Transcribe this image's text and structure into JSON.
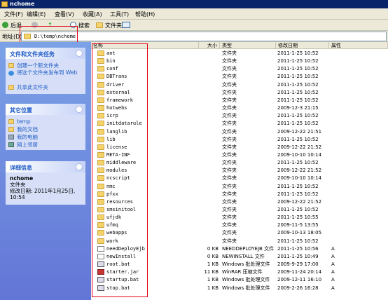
{
  "window": {
    "title": "nchome"
  },
  "menu": [
    "文件(F)",
    "编辑(E)",
    "查看(V)",
    "收藏(A)",
    "工具(T)",
    "帮助(H)"
  ],
  "toolbar": {
    "back": "后退",
    "search": "搜索",
    "folders": "文件夹"
  },
  "address": {
    "label": "地址(D)",
    "value": "D:\\temp\\nchome"
  },
  "tasks": {
    "header": "文件和文件夹任务",
    "items": [
      "创建一个新文件夹",
      "将这个文件夹发布到 Web",
      "共享此文件夹"
    ]
  },
  "places": {
    "header": "其它位置",
    "items": [
      "temp",
      "我的文档",
      "我的电脑",
      "网上邻居"
    ]
  },
  "details": {
    "header": "详细信息",
    "name": "nchome",
    "type": "文件夹",
    "modified": "修改日期: 2011年1月25日, 10:54"
  },
  "columns": [
    "名称",
    "大小",
    "类型",
    "修改日期",
    "属性"
  ],
  "files": [
    {
      "name": "ant",
      "size": "",
      "type": "文件夹",
      "date": "2011-1-25 10:52",
      "attr": "",
      "kind": "folder"
    },
    {
      "name": "bin",
      "size": "",
      "type": "文件夹",
      "date": "2011-1-25 10:52",
      "attr": "",
      "kind": "folder"
    },
    {
      "name": "conf",
      "size": "",
      "type": "文件夹",
      "date": "2011-1-25 10:52",
      "attr": "",
      "kind": "folder"
    },
    {
      "name": "DBTrans",
      "size": "",
      "type": "文件夹",
      "date": "2011-1-25 10:52",
      "attr": "",
      "kind": "folder"
    },
    {
      "name": "driver",
      "size": "",
      "type": "文件夹",
      "date": "2011-1-25 10:52",
      "attr": "",
      "kind": "folder"
    },
    {
      "name": "external",
      "size": "",
      "type": "文件夹",
      "date": "2011-1-25 10:52",
      "attr": "",
      "kind": "folder"
    },
    {
      "name": "framework",
      "size": "",
      "type": "文件夹",
      "date": "2011-1-25 10:52",
      "attr": "",
      "kind": "folder"
    },
    {
      "name": "hotwebs",
      "size": "",
      "type": "文件夹",
      "date": "2009-12-3 21:15",
      "attr": "",
      "kind": "folder"
    },
    {
      "name": "icrp",
      "size": "",
      "type": "文件夹",
      "date": "2011-1-25 10:52",
      "attr": "",
      "kind": "folder"
    },
    {
      "name": "initdatarule",
      "size": "",
      "type": "文件夹",
      "date": "2011-1-25 10:52",
      "attr": "",
      "kind": "folder"
    },
    {
      "name": "langlib",
      "size": "",
      "type": "文件夹",
      "date": "2009-12-22 21:51",
      "attr": "",
      "kind": "folder"
    },
    {
      "name": "lib",
      "size": "",
      "type": "文件夹",
      "date": "2011-1-25 10:52",
      "attr": "",
      "kind": "folder"
    },
    {
      "name": "license",
      "size": "",
      "type": "文件夹",
      "date": "2009-12-22 21:52",
      "attr": "",
      "kind": "folder"
    },
    {
      "name": "META-INF",
      "size": "",
      "type": "文件夹",
      "date": "2009-10-10 10:14",
      "attr": "",
      "kind": "folder"
    },
    {
      "name": "middleware",
      "size": "",
      "type": "文件夹",
      "date": "2011-1-25 10:52",
      "attr": "",
      "kind": "folder"
    },
    {
      "name": "modules",
      "size": "",
      "type": "文件夹",
      "date": "2009-12-22 21:52",
      "attr": "",
      "kind": "folder"
    },
    {
      "name": "ncscript",
      "size": "",
      "type": "文件夹",
      "date": "2009-10-10 10:14",
      "attr": "",
      "kind": "folder"
    },
    {
      "name": "nmc",
      "size": "",
      "type": "文件夹",
      "date": "2011-1-25 10:52",
      "attr": "",
      "kind": "folder"
    },
    {
      "name": "pfxx",
      "size": "",
      "type": "文件夹",
      "date": "2011-1-25 10:52",
      "attr": "",
      "kind": "folder"
    },
    {
      "name": "resources",
      "size": "",
      "type": "文件夹",
      "date": "2009-12-22 21:52",
      "attr": "",
      "kind": "folder"
    },
    {
      "name": "smsinitool",
      "size": "",
      "type": "文件夹",
      "date": "2011-1-25 10:52",
      "attr": "",
      "kind": "folder"
    },
    {
      "name": "ufjdk",
      "size": "",
      "type": "文件夹",
      "date": "2011-1-25 10:55",
      "attr": "",
      "kind": "folder"
    },
    {
      "name": "ufmq",
      "size": "",
      "type": "文件夹",
      "date": "2009-11-5 13:55",
      "attr": "",
      "kind": "folder"
    },
    {
      "name": "webapps",
      "size": "",
      "type": "文件夹",
      "date": "2009-10-13 18:05",
      "attr": "",
      "kind": "folder"
    },
    {
      "name": "work",
      "size": "",
      "type": "文件夹",
      "date": "2011-1-25 10:52",
      "attr": "",
      "kind": "folder"
    },
    {
      "name": "needDeployEjb",
      "size": "0 KB",
      "type": "NEEDDEPLOYEJB 文件",
      "date": "2011-1-25 10:56",
      "attr": "A",
      "kind": "file"
    },
    {
      "name": "newInstall",
      "size": "0 KB",
      "type": "NEWINSTALL 文件",
      "date": "2011-1-25 10:49",
      "attr": "A",
      "kind": "file"
    },
    {
      "name": "root.bat",
      "size": "1 KB",
      "type": "Windows 批处理文件",
      "date": "2009-9-29 17:00",
      "attr": "A",
      "kind": "bat"
    },
    {
      "name": "starter.jar",
      "size": "11 KB",
      "type": "WinRAR 压缩文件",
      "date": "2009-11-24 20:14",
      "attr": "A",
      "kind": "jar"
    },
    {
      "name": "startup.bat",
      "size": "1 KB",
      "type": "Windows 批处理文件",
      "date": "2009-12-11 16:10",
      "attr": "A",
      "kind": "bat"
    },
    {
      "name": "stop.bat",
      "size": "1 KB",
      "type": "Windows 批处理文件",
      "date": "2009-2-26 16:28",
      "attr": "A",
      "kind": "bat"
    }
  ]
}
